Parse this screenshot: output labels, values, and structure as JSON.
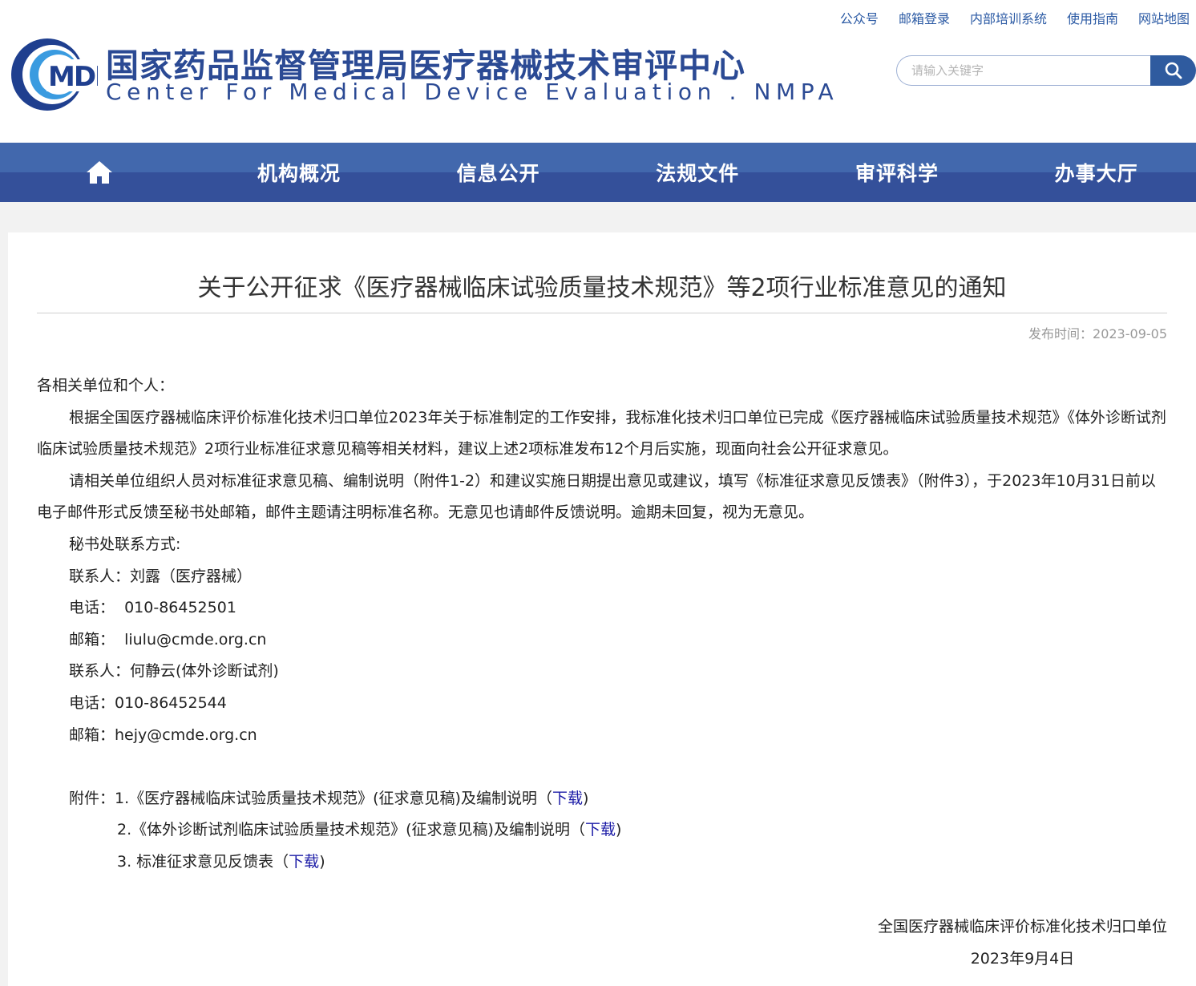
{
  "header": {
    "top_links": [
      "公众号",
      "邮箱登录",
      "内部培训系统",
      "使用指南",
      "网站地图"
    ],
    "logo_text": "MDE",
    "title_cn": "国家药品监督管理局医疗器械技术审评中心",
    "title_en": "Center For Medical Device Evaluation . NMPA",
    "search_placeholder": "请输入关键字"
  },
  "nav": {
    "home_icon": "home-icon",
    "items": [
      "机构概况",
      "信息公开",
      "法规文件",
      "审评科学",
      "办事大厅"
    ]
  },
  "article": {
    "title": "关于公开征求《医疗器械临床试验质量技术规范》等2项行业标准意见的通知",
    "pub_label": "发布时间：",
    "pub_date": "2023-09-05",
    "salutation": "各相关单位和个人：",
    "para1": "根据全国医疗器械临床评价标准化技术归口单位2023年关于标准制定的工作安排，我标准化技术归口单位已完成《医疗器械临床试验质量技术规范》《体外诊断试剂临床试验质量技术规范》2项行业标准征求意见稿等相关材料，建议上述2项标准发布12个月后实施，现面向社会公开征求意见。",
    "para2": "请相关单位组织人员对标准征求意见稿、编制说明（附件1-2）和建议实施日期提出意见或建议，填写《标准征求意见反馈表》（附件3），于2023年10月31日前以电子邮件形式反馈至秘书处邮箱，邮件主题请注明标准名称。无意见也请邮件反馈说明。逾期未回复，视为无意见。",
    "contact_heading": "秘书处联系方式:",
    "contacts": [
      "联系人：刘露（医疗器械）",
      "电话：  010-86452501",
      "邮箱：  liulu@cmde.org.cn",
      "联系人：何静云(体外诊断试剂)",
      "电话：010-86452544",
      "邮箱：hejy@cmde.org.cn"
    ],
    "attach_label": "附件：",
    "attachments": [
      {
        "text": "1.《医疗器械临床试验质量技术规范》(征求意见稿)及编制说明（",
        "link": "下载",
        "close": ")"
      },
      {
        "text": "2.《体外诊断试剂临床试验质量技术规范》(征求意见稿)及编制说明（",
        "link": "下载",
        "close": ")"
      },
      {
        "text": "3. 标准征求意见反馈表（",
        "link": "下载",
        "close": ")"
      }
    ],
    "signature_org": "全国医疗器械临床评价标准化技术归口单位",
    "signature_date": "2023年9月4日"
  }
}
